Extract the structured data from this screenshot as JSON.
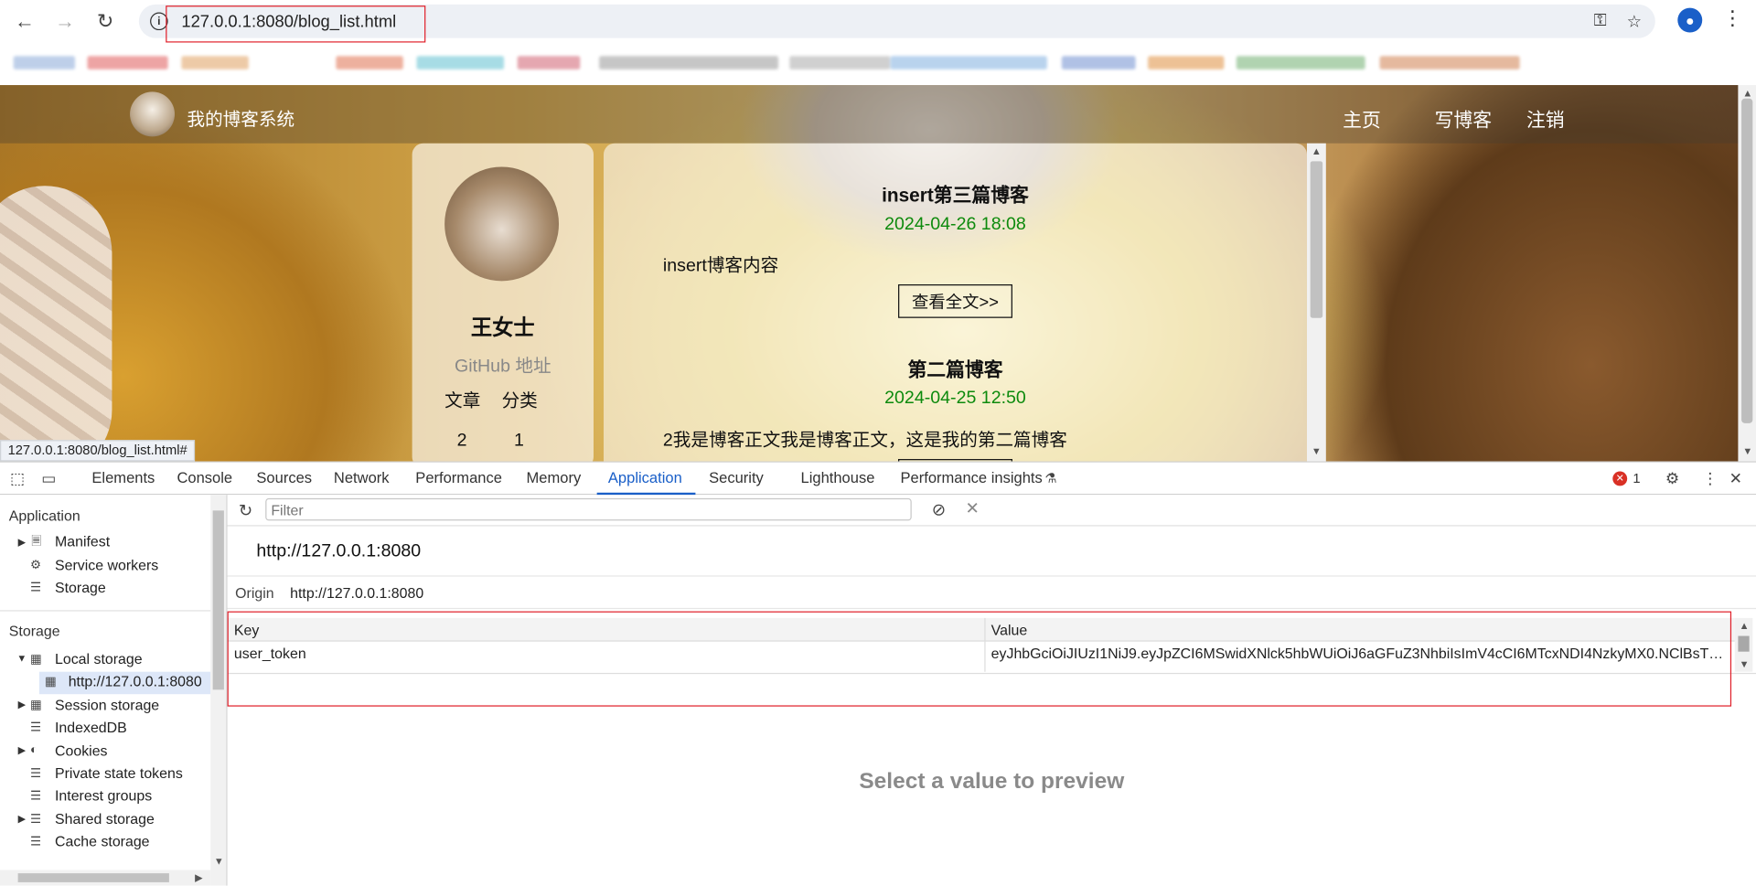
{
  "browser": {
    "url": "127.0.0.1:8080/blog_list.html",
    "status_url": "127.0.0.1:8080/blog_list.html#"
  },
  "site": {
    "name": "我的博客系统",
    "nav": [
      "主页",
      "写博客",
      "注销"
    ]
  },
  "profile": {
    "name": "王女士",
    "github": "GitHub 地址",
    "stat_labels": [
      "文章",
      "分类"
    ],
    "stat_values": [
      "2",
      "1"
    ]
  },
  "posts": [
    {
      "title": "insert第三篇博客",
      "date": "2024-04-26 18:08",
      "desc": "insert博客内容",
      "more": "查看全文>>"
    },
    {
      "title": "第二篇博客",
      "date": "2024-04-25 12:50",
      "desc": "2我是博客正文我是博客正文，这是我的第二篇博客"
    }
  ],
  "devtools": {
    "tabs": [
      "Elements",
      "Console",
      "Sources",
      "Network",
      "Performance",
      "Memory",
      "Application",
      "Security",
      "Lighthouse",
      "Performance insights"
    ],
    "active_tab": "Application",
    "error_count": "1",
    "sidebar": {
      "application_header": "Application",
      "application_items": [
        "Manifest",
        "Service workers",
        "Storage"
      ],
      "storage_header": "Storage",
      "storage_items": [
        "Local storage",
        "http://127.0.0.1:8080",
        "Session storage",
        "IndexedDB",
        "Cookies",
        "Private state tokens",
        "Interest groups",
        "Shared storage",
        "Cache storage"
      ]
    },
    "filter_placeholder": "Filter",
    "origin_title": "http://127.0.0.1:8080",
    "origin_label": "Origin",
    "origin_value": "http://127.0.0.1:8080",
    "table": {
      "headers": [
        "Key",
        "Value"
      ],
      "rows": [
        {
          "key": "user_token",
          "value": "eyJhbGciOiJIUzI1NiJ9.eyJpZCI6MSwidXNlck5hbWUiOiJ6aGFuZ3NhbiIsImV4cCI6MTcxNDI4NzkyMX0.NClBsTDxrE..."
        }
      ]
    },
    "preview_text": "Select a value to preview"
  },
  "colors": {
    "accent": "#1a5fc8",
    "highlight": "#e0202a",
    "date": "#0d8a0d"
  }
}
